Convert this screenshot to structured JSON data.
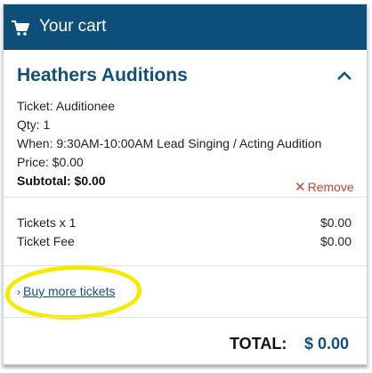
{
  "header": {
    "title": "Your cart",
    "icon": "cart-icon"
  },
  "event": {
    "title": "Heathers Auditions",
    "ticket": "Ticket: Auditionee",
    "qty": "Qty: 1",
    "when": "When: 9:30AM-10:00AM Lead Singing / Acting Audition",
    "price": "Price: $0.00",
    "subtotal": "Subtotal: $0.00",
    "remove_label": "Remove"
  },
  "fees": [
    {
      "label": "Tickets x 1",
      "value": "$0.00"
    },
    {
      "label": "Ticket Fee",
      "value": "$0.00"
    }
  ],
  "buy_more_label": "Buy more tickets",
  "total": {
    "label": "TOTAL:",
    "value": "$ 0.00"
  },
  "colors": {
    "header_bg": "#0d4f79",
    "accent": "#12507a",
    "remove": "#c4452a",
    "highlight": "#f5ea00"
  }
}
